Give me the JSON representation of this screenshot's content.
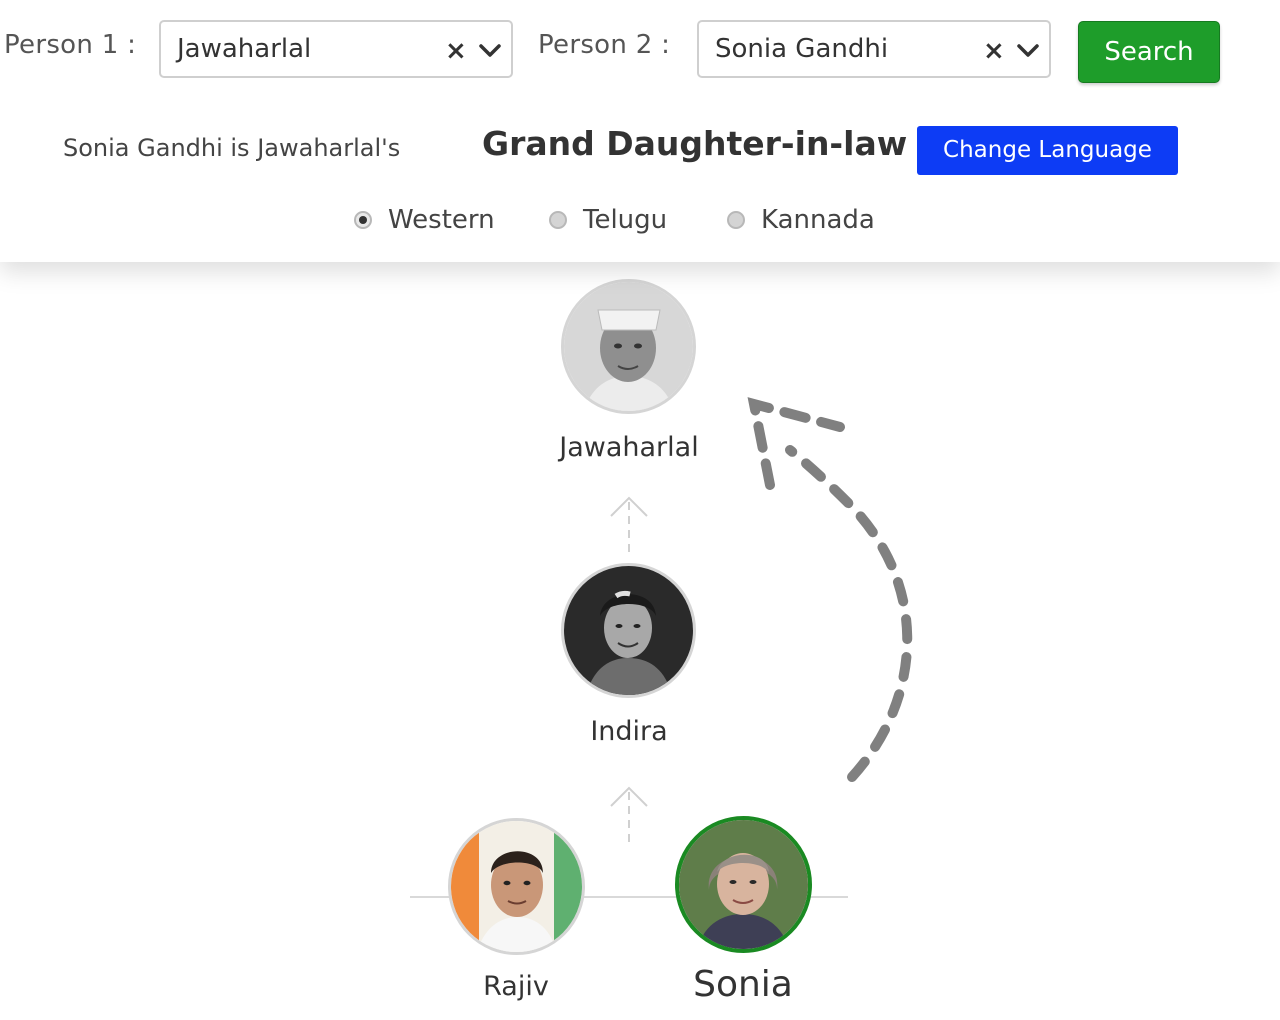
{
  "form": {
    "person1_label": "Person 1 :",
    "person1_value": "Jawaharlal",
    "person2_label": "Person 2 :",
    "person2_value": "Sonia Gandhi",
    "clear_glyph": "×",
    "search_label": "Search"
  },
  "result": {
    "sentence": "Sonia Gandhi is Jawaharlal's",
    "relation": "Grand Daughter-in-law",
    "change_language_label": "Change Language"
  },
  "language_options": [
    {
      "label": "Western",
      "checked": true
    },
    {
      "label": "Telugu",
      "checked": false
    },
    {
      "label": "Kannada",
      "checked": false
    }
  ],
  "tree": {
    "nodes": [
      {
        "name": "Jawaharlal",
        "selected": false
      },
      {
        "name": "Indira",
        "selected": false
      },
      {
        "name": "Rajiv",
        "selected": false
      },
      {
        "name": "Sonia",
        "selected": true
      }
    ]
  },
  "colors": {
    "search_button": "#1e9d2a",
    "language_button": "#0d3cf5",
    "selected_ring": "#1a8a22",
    "dashed_arrow": "#808080"
  }
}
